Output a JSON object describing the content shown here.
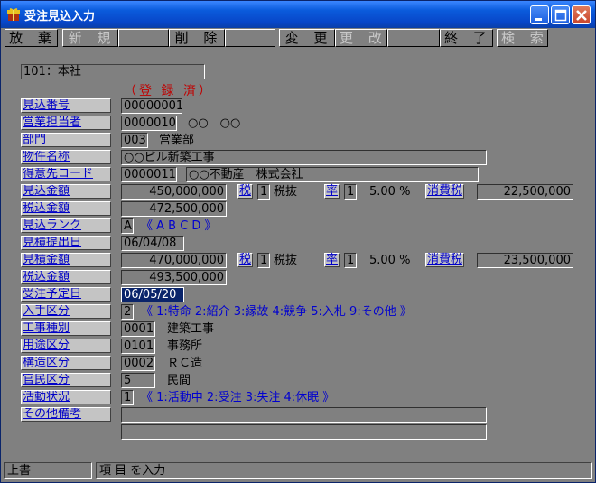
{
  "window": {
    "title": "受注見込入力"
  },
  "menu": {
    "discard": "放 棄",
    "new": "新 規",
    "delete": "削 除",
    "change": "変 更",
    "update": "更 改",
    "exit": "終 了",
    "search": "検 索"
  },
  "company": "101：本社",
  "reg_status": "（登 録 済）",
  "labels": {
    "estimate_no": "見込番号",
    "sales_rep": "営業担当者",
    "department": "部門",
    "property_name": "物件名称",
    "client_code": "得意先コード",
    "estimate_amount": "見込金額",
    "tax_incl_amount1": "税込金額",
    "estimate_rank": "見込ランク",
    "quote_date": "見積提出日",
    "quote_amount": "見積金額",
    "tax_incl_amount2": "税込金額",
    "order_date": "受注予定日",
    "source_type": "入手区分",
    "work_type": "工事種別",
    "usage_type": "用途区分",
    "structure_type": "構造区分",
    "public_private": "官民区分",
    "activity_status": "活動状況",
    "other_notes": "その他備考"
  },
  "values": {
    "estimate_no": "00000001",
    "sales_rep_code": "0000010",
    "sales_rep_name": "○○　○○",
    "dept_code": "003",
    "dept_name": "営業部",
    "property_name": "○○ビル新築工事",
    "client_code": "0000011",
    "client_name": "○○不動産　株式会社",
    "estimate_amount": "450,000,000",
    "tax_label": "税",
    "tax_code1": "1",
    "tax_type1": "税抜",
    "rate_label": "率",
    "rate_code1": "1",
    "rate_value1": "5.00 %",
    "cons_tax_label": "消費税",
    "cons_tax1": "22,500,000",
    "tax_incl1": "472,500,000",
    "rank_code": "A",
    "rank_hint": "《 A B C D 》",
    "quote_date": "06/04/08",
    "quote_amount": "470,000,000",
    "tax_code2": "1",
    "tax_type2": "税抜",
    "rate_code2": "1",
    "rate_value2": "5.00 %",
    "cons_tax2": "23,500,000",
    "tax_incl2": "493,500,000",
    "order_date": "06/05/20",
    "source_code": "2",
    "source_hint": "《 1:特命 2:紹介 3:縁故 4:競争 5:入札 9:その他 》",
    "work_code": "0001",
    "work_name": "建築工事",
    "usage_code": "0101",
    "usage_name": "事務所",
    "structure_code": "0002",
    "structure_name": "ＲＣ造",
    "public_code": "5",
    "public_name": "民間",
    "activity_code": "1",
    "activity_hint": "《 1:活動中 2:受注 3:失注 4:休眠 》",
    "notes1": "",
    "notes2": ""
  },
  "statusbar": {
    "mode": "上書",
    "message": "項 目 を入力"
  }
}
